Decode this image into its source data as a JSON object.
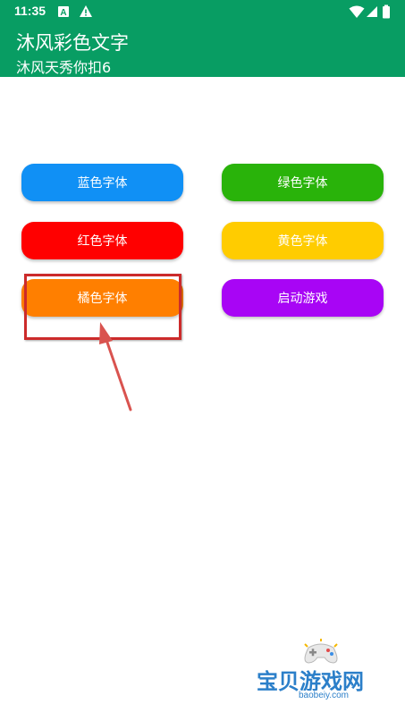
{
  "status_bar": {
    "time": "11:35",
    "left_icons": [
      "font-a-icon",
      "warning-icon"
    ],
    "right_icons": [
      "wifi-icon",
      "signal-icon",
      "battery-icon"
    ]
  },
  "header": {
    "title": "沐风彩色文字",
    "subtitle": "沐风天秀你扣6",
    "background_color": "#089d63"
  },
  "buttons": [
    {
      "label": "蓝色字体",
      "color": "#1090f5"
    },
    {
      "label": "绿色字体",
      "color": "#29b30a"
    },
    {
      "label": "红色字体",
      "color": "#ff0000"
    },
    {
      "label": "黄色字体",
      "color": "#ffcc00"
    },
    {
      "label": "橘色字体",
      "color": "#ff7f00"
    },
    {
      "label": "启动游戏",
      "color": "#a805f5"
    }
  ],
  "annotation": {
    "highlight_color": "#cc2b2b",
    "target": "橘色字体"
  },
  "watermark": {
    "text": "宝贝游戏网",
    "url": "baobeiy.com"
  }
}
